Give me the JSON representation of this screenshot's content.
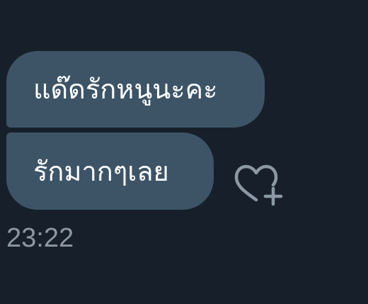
{
  "messages": [
    {
      "text": "แด๊ดรักหนูนะคะ"
    },
    {
      "text": "รักมากๆเลย"
    }
  ],
  "timestamp": "23:22",
  "icons": {
    "react": "heart-plus-icon"
  },
  "colors": {
    "background": "#17202a",
    "bubble": "#3d5467",
    "bubble_text": "#ffffff",
    "timestamp": "#8c98a4",
    "icon": "#8c98a4"
  }
}
